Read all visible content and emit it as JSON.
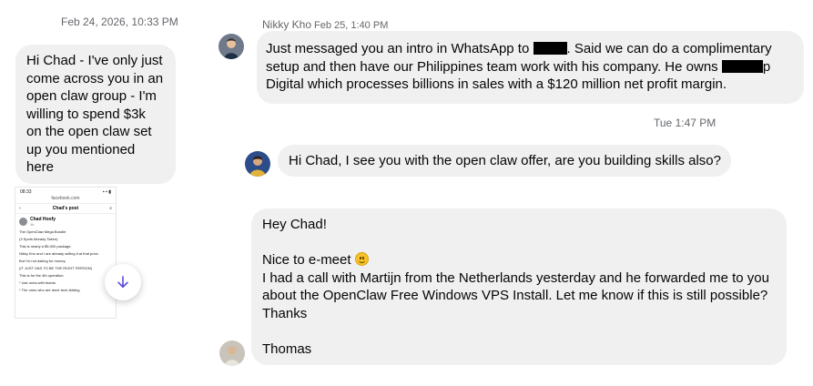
{
  "timestamps": {
    "left_date": "Feb 24, 2026, 10:33 PM",
    "tue": "Tue 1:47 PM"
  },
  "messages": {
    "chad_outgoing": {
      "lines": [
        "Hi Chad - I've only just",
        "come across you in an",
        "open claw group - I'm",
        "willing to spend $3k",
        "on the open claw set",
        "up you mentioned",
        "here"
      ]
    },
    "nikky": {
      "sender_name": "Nikky Kho",
      "sender_time": "Feb 25, 1:40 PM",
      "line1_a": "Just messaged you an intro in WhatsApp to",
      "line1_b": ". Said we can do a complimentary",
      "line2_a": "setup and then have our Philippines team work with his company. He owns",
      "line2_b": "p",
      "line3": "Digital which processes billions in sales with a $120 million net profit margin."
    },
    "tue_msg": {
      "text": "Hi Chad, I see you with the open claw offer, are you building skills also?"
    },
    "thomas": {
      "greeting": "Hey Chad!",
      "nice": "Nice to e-meet",
      "body1": "I had a call with Martijn from the Netherlands yesterday and he forwarded me to you",
      "body2": "about the OpenClaw Free Windows VPS Install. Let me know if this is still possible?",
      "thanks": "Thanks",
      "signature": "Thomas"
    }
  },
  "attachment": {
    "status_time": "08:33",
    "url": "facebook.com",
    "header": "Chad's post",
    "poster_name": "Chad Hoofy",
    "poster_meta": "1h",
    "lines": [
      "The OpenClaw Mega Bundle",
      "(3 Spots Already Taken)",
      "This is nearly a $5,000 package.",
      "Nikky Kho and I are already selling it at that price.",
      "But I'm not asking for money.",
      "(IT JUST HAS TO BE THE RIGHT PERSON)",
      "This is for the 4th operation.",
      "* Use ones with teams.",
      "* The ones who are done tech-fidding"
    ]
  },
  "icons": {
    "scroll_down": "arrow-down-icon",
    "emoji": "smiling-face-emoji"
  },
  "colors": {
    "bubble": "#f0f0f0",
    "timestamp": "#65676b",
    "scroll_arrow": "#5b51d8"
  }
}
